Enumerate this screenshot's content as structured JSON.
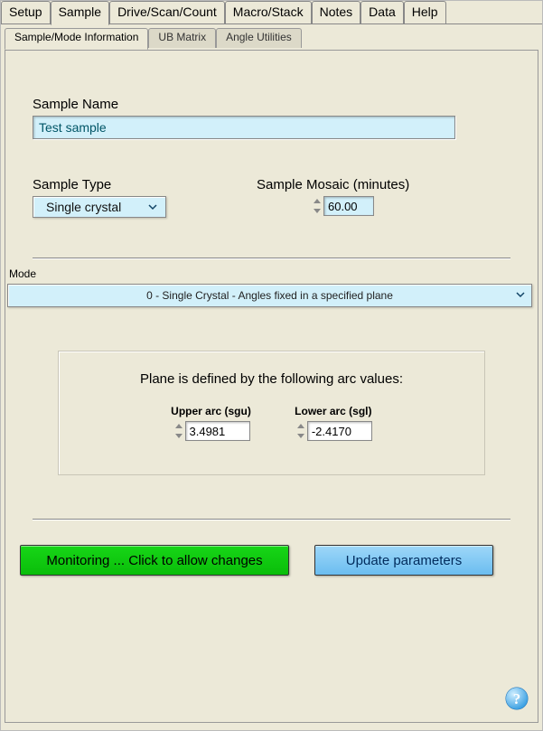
{
  "main_tabs": {
    "setup": "Setup",
    "sample": "Sample",
    "drive": "Drive/Scan/Count",
    "macro": "Macro/Stack",
    "notes": "Notes",
    "data": "Data",
    "help": "Help"
  },
  "sub_tabs": {
    "info": "Sample/Mode Information",
    "ub": "UB Matrix",
    "angle": "Angle Utilities"
  },
  "sample_name": {
    "label": "Sample Name",
    "value": "Test sample"
  },
  "sample_type": {
    "label": "Sample Type",
    "value": "Single crystal"
  },
  "sample_mosaic": {
    "label": "Sample Mosaic (minutes)",
    "value": "60.00"
  },
  "mode": {
    "label": "Mode",
    "value": "0 - Single Crystal - Angles fixed in a specified plane"
  },
  "plane": {
    "title": "Plane is defined by the following arc values:",
    "upper_label": "Upper arc (sgu)",
    "upper_value": "3.4981",
    "lower_label": "Lower arc (sgl)",
    "lower_value": "-2.4170"
  },
  "buttons": {
    "monitoring": "Monitoring ... Click to allow changes",
    "update": "Update parameters"
  },
  "icons": {
    "help": "help-icon"
  }
}
